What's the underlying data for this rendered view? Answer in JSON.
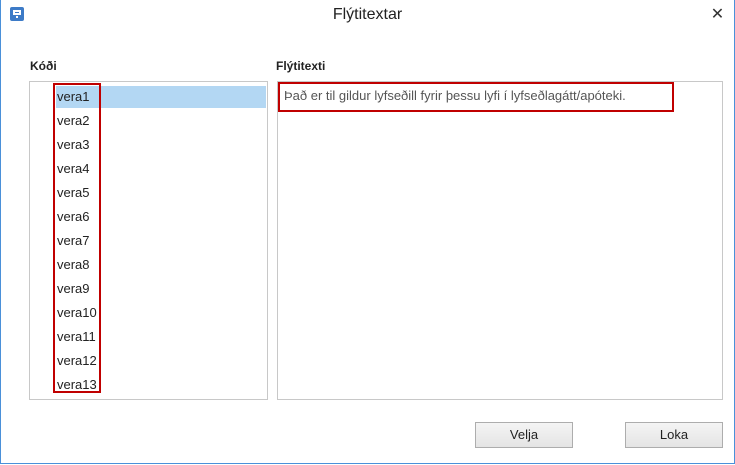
{
  "window": {
    "title": "Flýtitextar",
    "close_glyph": "✕"
  },
  "left_panel": {
    "label": "Kóði",
    "items": [
      "vera1",
      "vera2",
      "vera3",
      "vera4",
      "vera5",
      "vera6",
      "vera7",
      "vera8",
      "vera9",
      "vera10",
      "vera11",
      "vera12",
      "vera13"
    ],
    "selected": "vera1"
  },
  "right_panel": {
    "label": "Flýtitexti",
    "text": "Það er til gildur lyfseðill fyrir þessu lyfi í lyfseðlagátt/apóteki."
  },
  "buttons": {
    "select_label": "Velja",
    "close_label": "Loka"
  },
  "colors": {
    "selection": "#b3d7f3",
    "highlight_border": "#c00000",
    "window_border": "#4a90d9"
  }
}
